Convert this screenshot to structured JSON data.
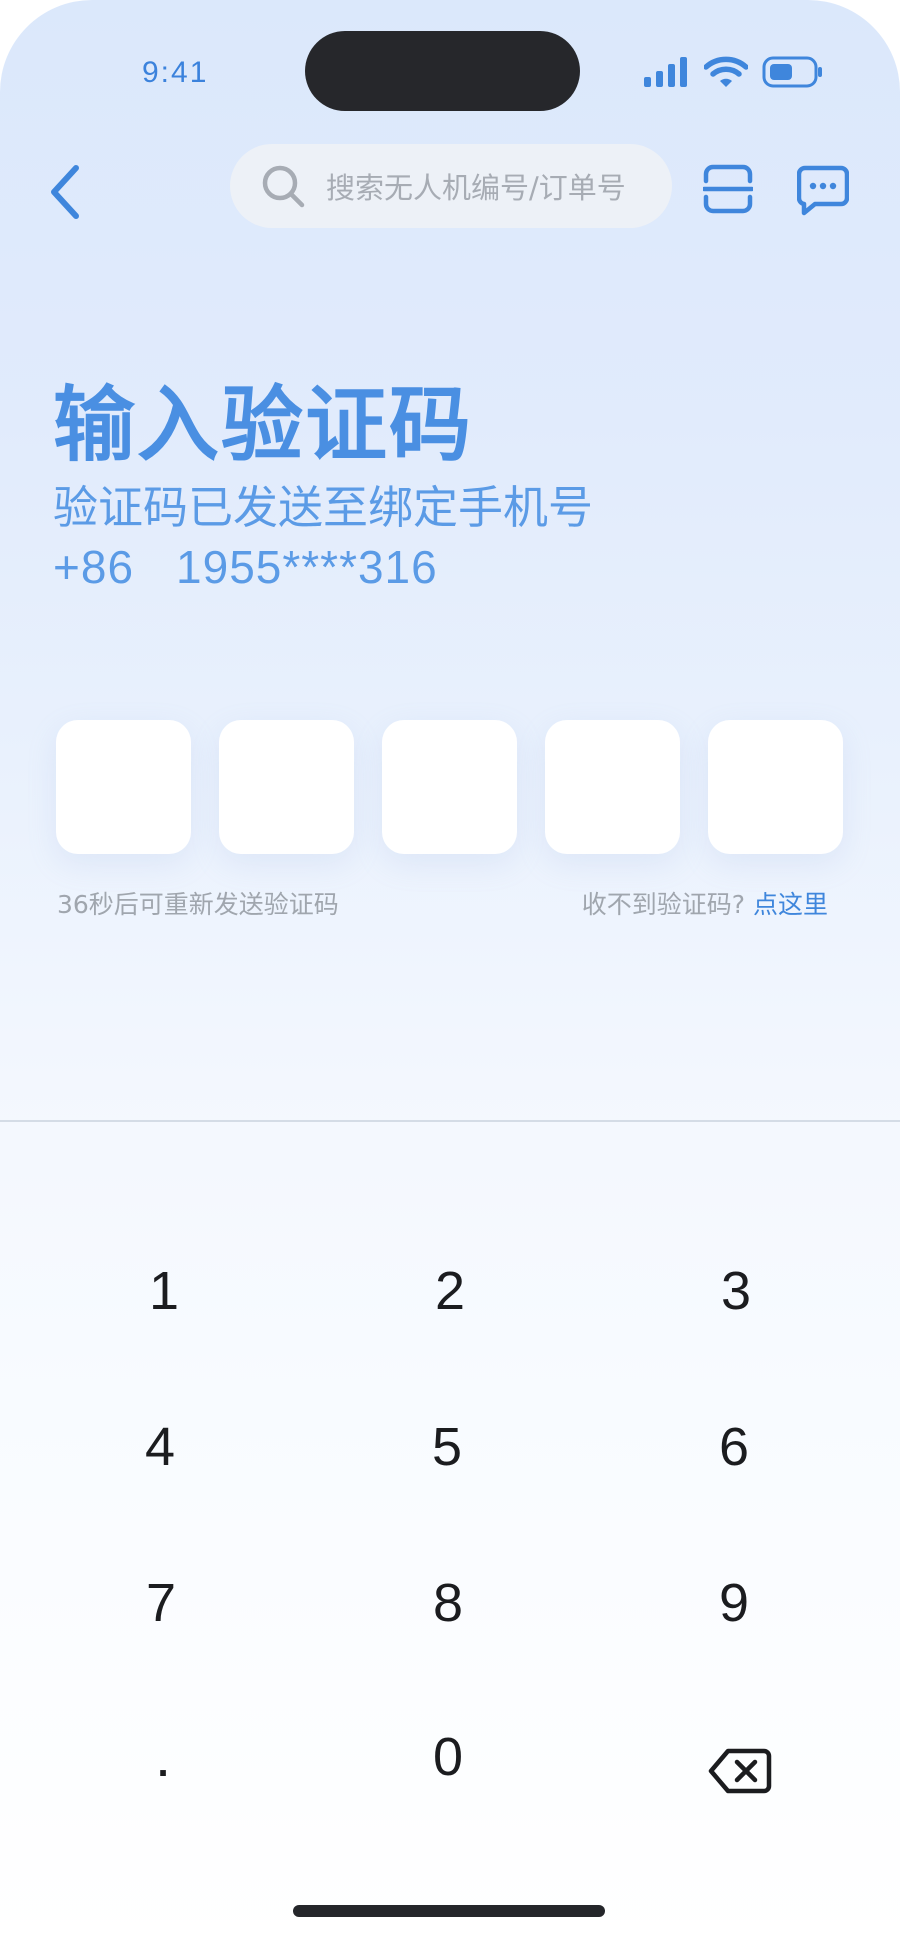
{
  "status_bar": {
    "time": "9:41"
  },
  "nav": {
    "search_placeholder": "搜索无人机编号/订单号",
    "icons": [
      "back-chevron-icon",
      "search-icon",
      "scan-icon",
      "message-icon"
    ]
  },
  "verify": {
    "title": "输入验证码",
    "subtitle": "验证码已发送至绑定手机号",
    "country_code": "+86",
    "phone_masked": "1955****316",
    "code_digits": 5,
    "resend_text": "36秒后可重新发送验证码",
    "help_text": "收不到验证码?",
    "help_link": "点这里"
  },
  "keypad": {
    "keys": [
      "1",
      "2",
      "3",
      "4",
      "5",
      "6",
      "7",
      "8",
      "9",
      ".",
      "0",
      "delete"
    ]
  },
  "colors": {
    "accent": "#4a8fe2",
    "link": "#3f86dc",
    "muted_text": "#a0a6ae",
    "key_text": "#1b1c1f"
  }
}
